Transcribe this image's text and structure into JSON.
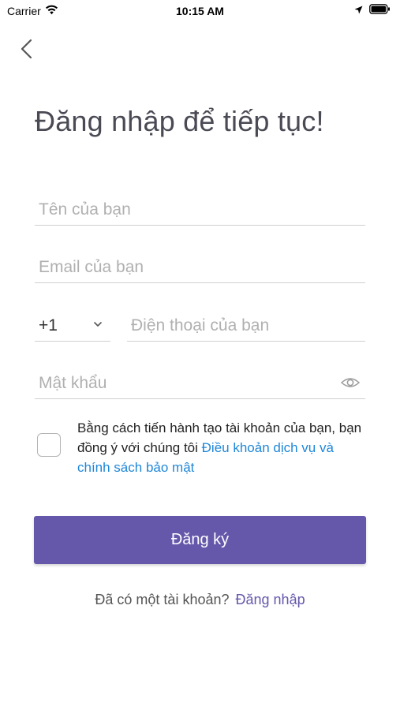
{
  "status_bar": {
    "carrier": "Carrier",
    "time": "10:15 AM",
    "icons": [
      "wifi-icon",
      "location-arrow-icon",
      "battery-icon"
    ]
  },
  "nav": {
    "back_icon": "chevron-left-icon"
  },
  "title": "Đăng nhập để tiếp tục!",
  "form": {
    "name": {
      "value": "",
      "placeholder": "Tên của bạn"
    },
    "email": {
      "value": "",
      "placeholder": "Email của bạn"
    },
    "country_code": {
      "value": "+1",
      "icon": "chevron-down-icon"
    },
    "phone": {
      "value": "",
      "placeholder": "Điện thoại của bạn"
    },
    "password": {
      "value": "",
      "placeholder": "Mật khẩu",
      "icon": "eye-icon"
    }
  },
  "terms": {
    "checked": false,
    "text": "Bằng cách tiến hành tạo tài khoản của bạn, bạn đồng ý với chúng tôi",
    "link": "Điều khoản dịch vụ và chính sách bảo mật"
  },
  "signup_button": "Đăng ký",
  "login_prompt": {
    "text": "Đã có một tài khoản?",
    "link": "Đăng nhập"
  },
  "colors": {
    "primary": "#6558ab",
    "link": "#1f87d8",
    "title": "#4a4a55",
    "placeholder": "#b0b0b0",
    "divider": "#cfcfcf"
  }
}
